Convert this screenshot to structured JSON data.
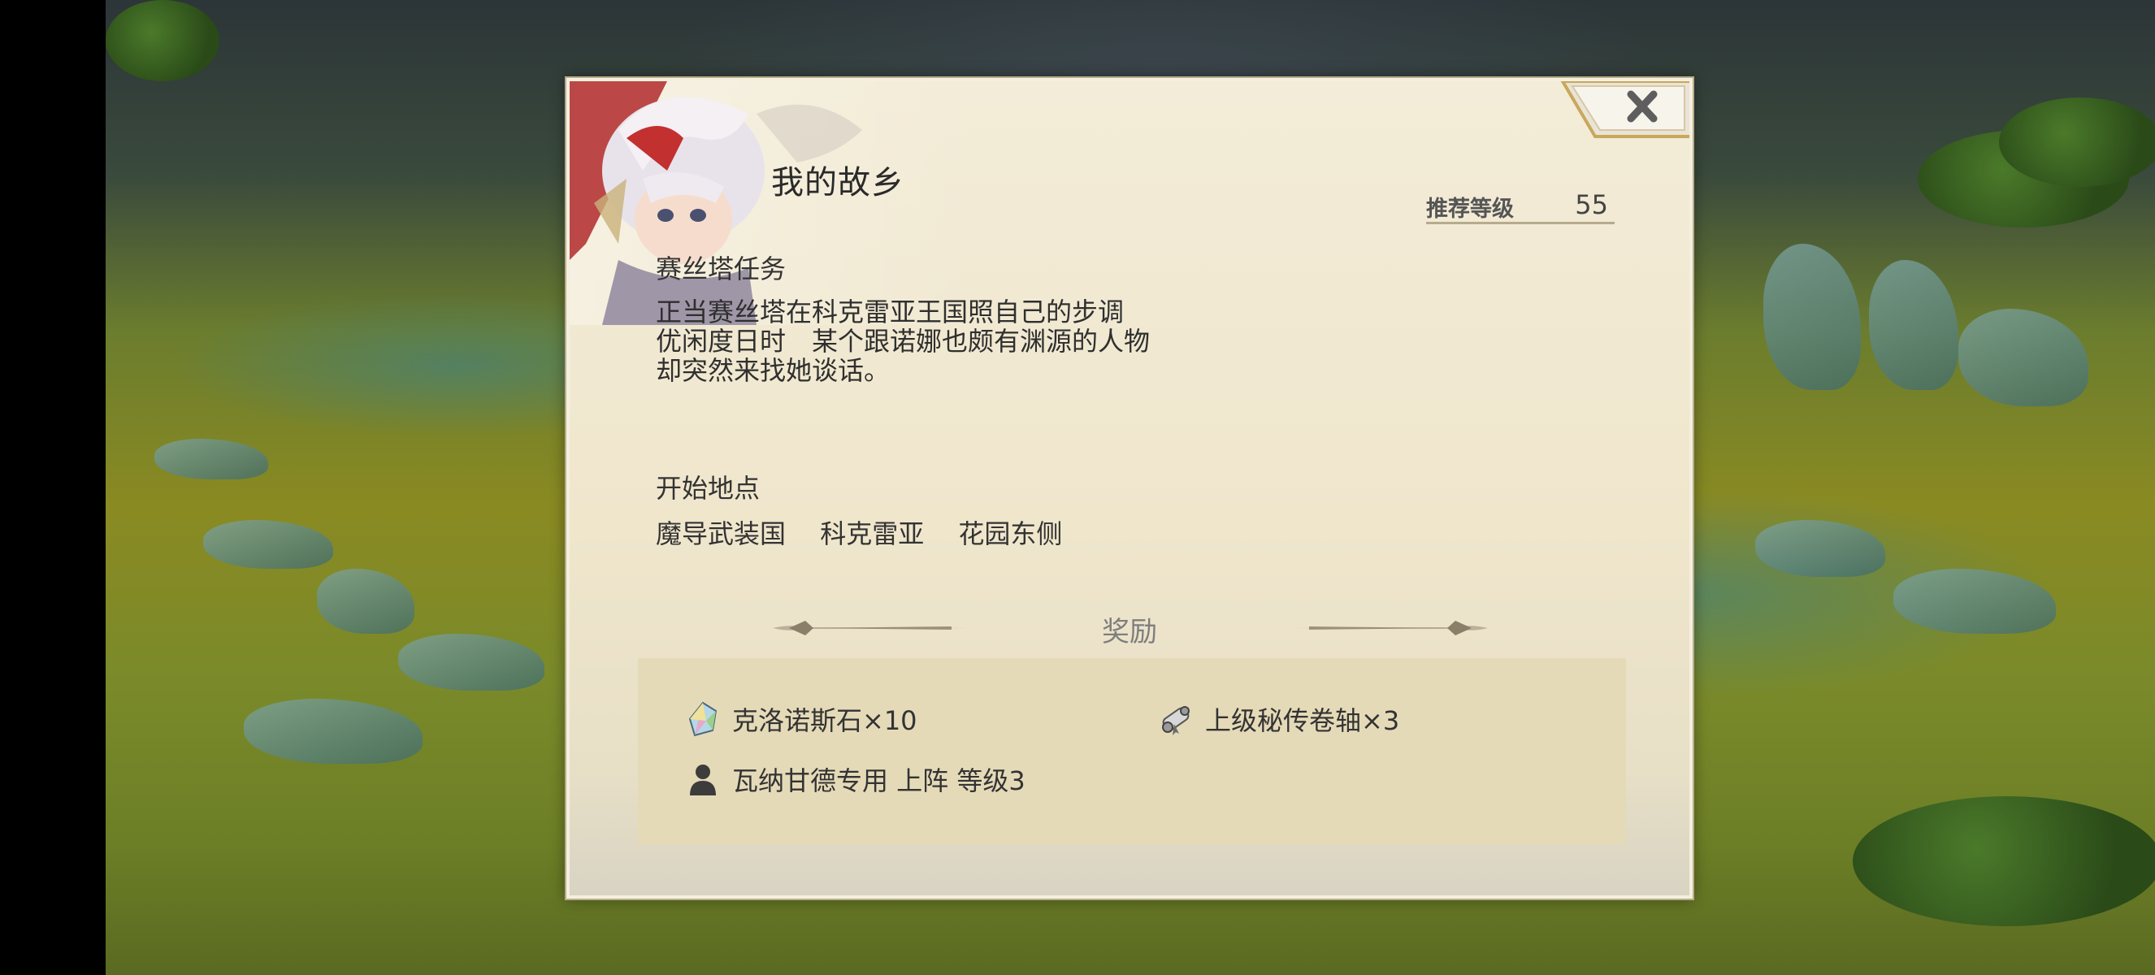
{
  "dialog": {
    "title": "我的故乡",
    "recommended_level_label": "推荐等级",
    "recommended_level_value": "55",
    "category": "赛丝塔任务",
    "description_lines": [
      "正当赛丝塔在科克雷亚王国照自己的步调",
      "优闲度日时　某个跟诺娜也颇有渊源的人物",
      "却突然来找她谈话。"
    ],
    "start_label": "开始地点",
    "start_location": [
      "魔导武装国",
      "科克雷亚",
      "花园东侧"
    ],
    "rewards_title": "奖励",
    "rewards": [
      {
        "icon": "crystal-icon",
        "text": "克洛诺斯石×10"
      },
      {
        "icon": "scroll-icon",
        "text": "上级秘传卷轴×3"
      },
      {
        "icon": "person-icon",
        "text": "瓦纳甘德专用 上阵 等级3"
      }
    ],
    "close_icon": "close-icon"
  }
}
